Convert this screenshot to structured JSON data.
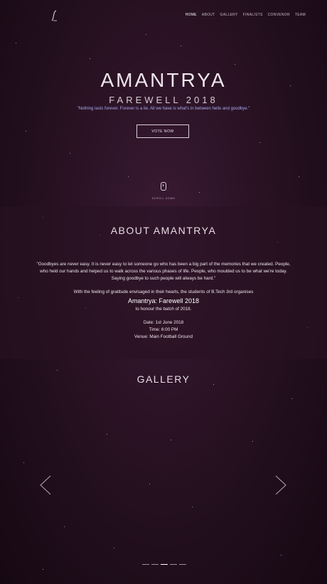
{
  "nav": {
    "items": [
      {
        "label": "HOME",
        "active": true
      },
      {
        "label": "ABOUT",
        "active": false
      },
      {
        "label": "GALLERY",
        "active": false
      },
      {
        "label": "FINALISTS",
        "active": false
      },
      {
        "label": "CONVENOR",
        "active": false
      },
      {
        "label": "TEAM",
        "active": false
      }
    ],
    "logo_icon": "logo-icon"
  },
  "hero": {
    "title": "AMANTRYA",
    "subtitle": "FAREWELL 2018",
    "quote": "\"Nothing lasts forever. Forever is a lie. All we have is what's in between hello and goodbye.\"",
    "vote_button": "VOTE NOW",
    "scroll_label": "SCROLL DOWN"
  },
  "about": {
    "title": "ABOUT AMANTRYA",
    "paragraph": "\"Goodbyes are never easy. It is never easy to let someone go who has been a big part of the memories that we created. People, who held our hands and helped us to walk across the various phases of life. People, who moulded us to be what we're today. Saying goodbye to such people will always be hard.\"",
    "gratitude": "With the feeling of gratitude envisaged in their hearts, the students of B.Tech 3rd organises",
    "event_name": "Amantrya: Farewell 2018",
    "honour": "to honour the batch of 2018.",
    "date": "Date: 1st June 2018",
    "time": "Time: 6:00 PM",
    "venue": "Venue: Main Football Ground"
  },
  "gallery": {
    "title": "GALLERY",
    "slides": [
      {
        "active": false
      },
      {
        "active": false
      },
      {
        "active": true
      },
      {
        "active": false
      },
      {
        "active": false
      }
    ]
  },
  "colors": {
    "background": "#24101f",
    "quote": "#a9a7ee",
    "text": "#efe6ee"
  }
}
